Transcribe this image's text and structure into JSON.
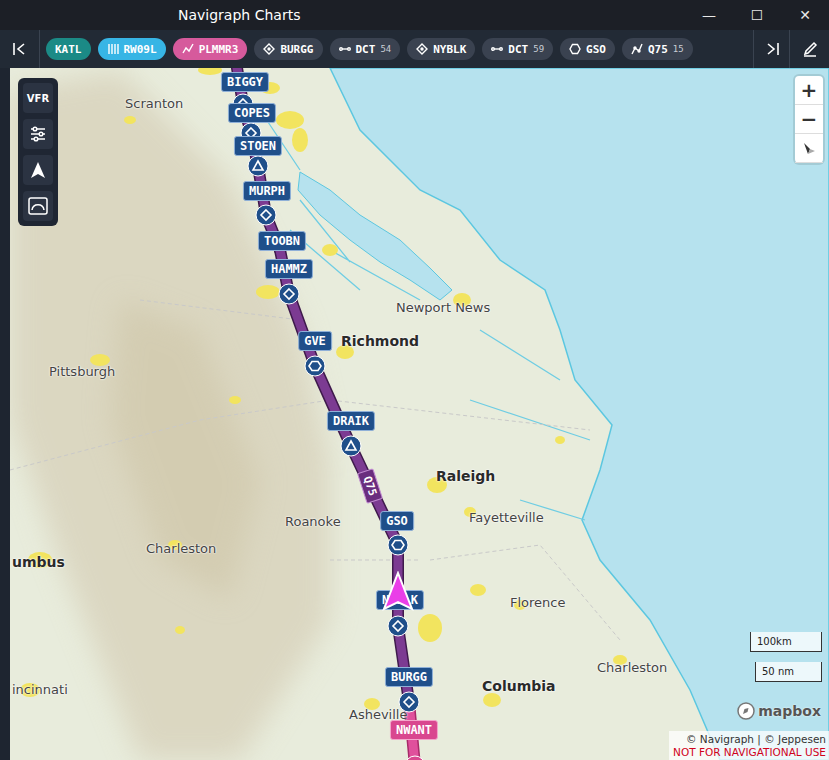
{
  "window": {
    "title": "Navigraph Charts",
    "controls": [
      "—",
      "☐",
      "✕"
    ]
  },
  "route_bar": {
    "chips": [
      {
        "label": "KATL",
        "kind": "airport",
        "count": ""
      },
      {
        "label": "RW09L",
        "kind": "runway",
        "count": ""
      },
      {
        "label": "PLMMR3",
        "kind": "procedure",
        "count": ""
      },
      {
        "label": "BURGG",
        "kind": "waypoint",
        "count": ""
      },
      {
        "label": "DCT",
        "kind": "direct",
        "count": "54"
      },
      {
        "label": "NYBLK",
        "kind": "waypoint",
        "count": ""
      },
      {
        "label": "DCT",
        "kind": "direct",
        "count": "59"
      },
      {
        "label": "GSO",
        "kind": "vor",
        "count": ""
      },
      {
        "label": "Q75",
        "kind": "airway",
        "count": "15"
      }
    ]
  },
  "map_tools": [
    {
      "label": "VFR",
      "kind": "text"
    },
    {
      "label": "",
      "kind": "sliders"
    },
    {
      "label": "",
      "kind": "north"
    },
    {
      "label": "",
      "kind": "curve"
    }
  ],
  "zoom": [
    "+",
    "−"
  ],
  "waypoints": [
    {
      "label": "BIGGY",
      "kind": "fix",
      "on_procedure": false
    },
    {
      "label": "COPES",
      "kind": "fix",
      "on_procedure": false
    },
    {
      "label": "STOEN",
      "kind": "triangle",
      "on_procedure": false
    },
    {
      "label": "MURPH",
      "kind": "fix",
      "on_procedure": false
    },
    {
      "label": "TOOBN",
      "kind": "none",
      "on_procedure": false
    },
    {
      "label": "HAMMZ",
      "kind": "fix",
      "on_procedure": false
    },
    {
      "label": "GVE",
      "kind": "vor",
      "on_procedure": false
    },
    {
      "label": "DRAIK",
      "kind": "triangle",
      "on_procedure": false
    },
    {
      "label": "GSO",
      "kind": "vor",
      "on_procedure": false
    },
    {
      "label": "NYBLK",
      "kind": "fix",
      "on_procedure": false
    },
    {
      "label": "BURGG",
      "kind": "fix",
      "on_procedure": false
    },
    {
      "label": "NWANT",
      "kind": "fix",
      "on_procedure": true
    }
  ],
  "airway_label": "Q75",
  "cities": [
    {
      "name": "Scranton",
      "capital": false
    },
    {
      "name": "Newport News",
      "capital": false
    },
    {
      "name": "Richmond",
      "capital": true
    },
    {
      "name": "Pittsburgh",
      "capital": false
    },
    {
      "name": "Raleigh",
      "capital": true
    },
    {
      "name": "Roanoke",
      "capital": false
    },
    {
      "name": "Fayetteville",
      "capital": false
    },
    {
      "name": "Charleston",
      "capital": false
    },
    {
      "name": "umbus",
      "capital": true
    },
    {
      "name": "Florence",
      "capital": false
    },
    {
      "name": "Charleston",
      "capital": false
    },
    {
      "name": "Columbia",
      "capital": true
    },
    {
      "name": "Asheville",
      "capital": false
    },
    {
      "name": "incinnati",
      "capital": false
    }
  ],
  "scale": [
    "100km",
    "50 nm"
  ],
  "attribution": {
    "logo": "mapbox",
    "credits": "© Navigraph | © Jeppesen",
    "warning": "NOT FOR NAVIGATIONAL USE"
  }
}
